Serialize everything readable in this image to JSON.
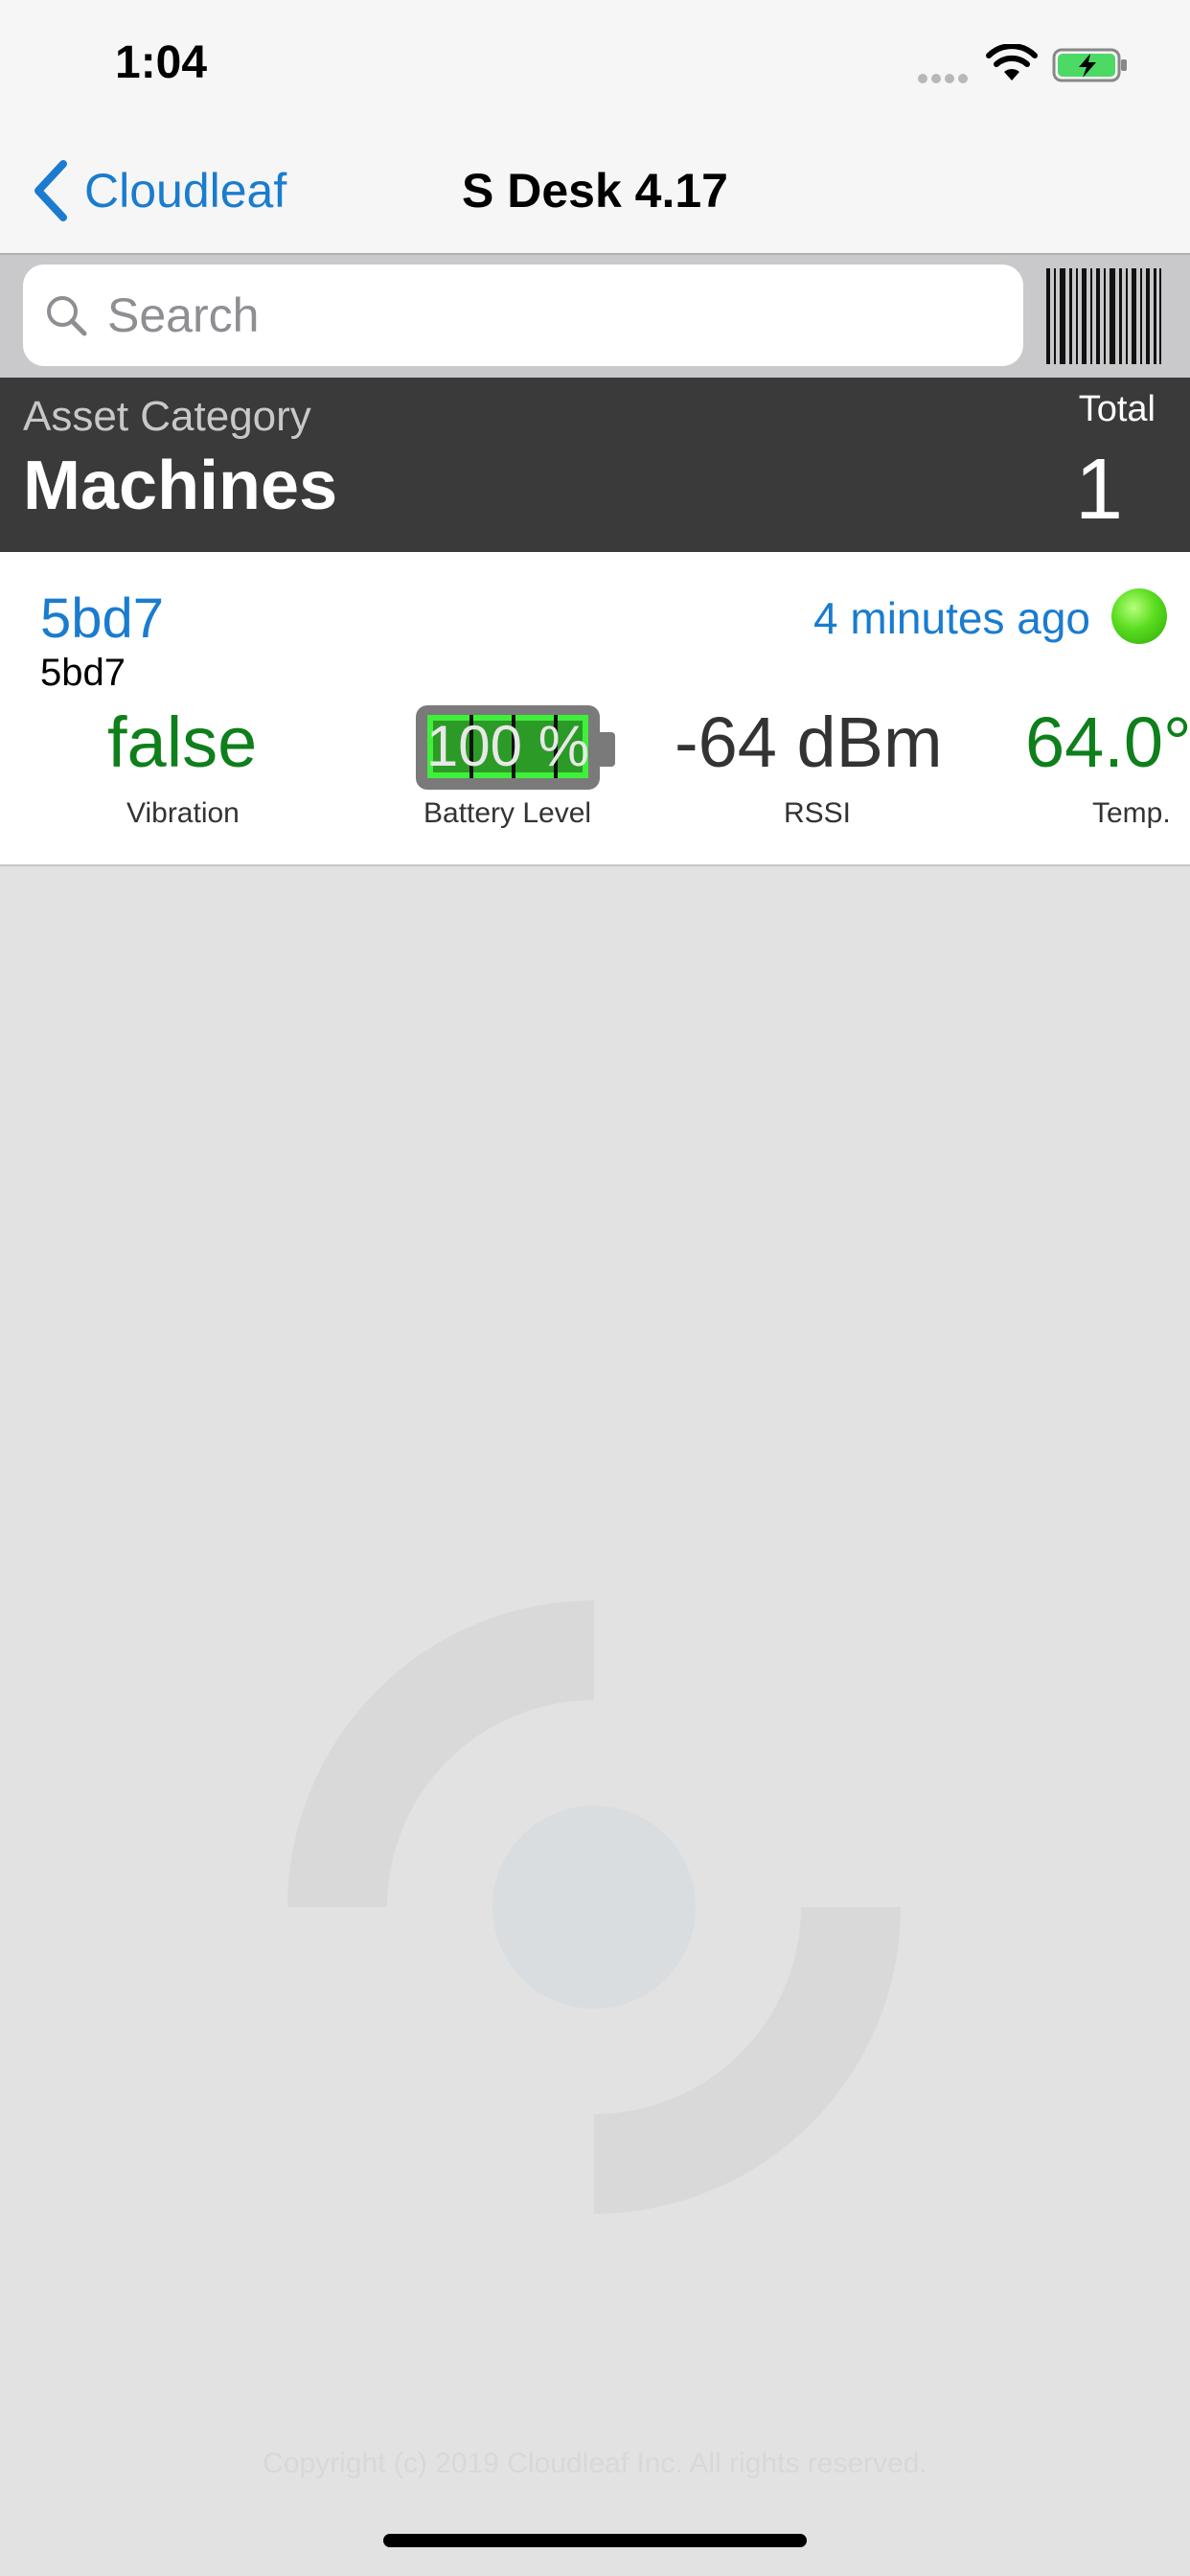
{
  "status_bar": {
    "time": "1:04"
  },
  "nav": {
    "back_label": "Cloudleaf",
    "title": "S Desk  4.17"
  },
  "search": {
    "placeholder": "Search"
  },
  "category": {
    "label": "Asset Category",
    "name": "Machines",
    "total_label": "Total",
    "total_value": "1"
  },
  "asset": {
    "id": "5bd7",
    "sub_id": "5bd7",
    "last_seen": "4 minutes ago",
    "status_color": "#59dc1e",
    "vibration": {
      "value": "false",
      "label": "Vibration"
    },
    "battery": {
      "value": "100 %",
      "level_percent": 100,
      "label": "Battery Level"
    },
    "rssi": {
      "value": "-64 dBm",
      "label": "RSSI"
    },
    "temp": {
      "value": "64.0°",
      "label": "Temp."
    }
  },
  "footer": {
    "copyright": "Copyright (c) 2019 Cloudleaf Inc. All rights reserved."
  },
  "colors": {
    "accent": "#1a7ccf",
    "good": "#0e7f1b",
    "header_bg": "#3a3a3a"
  }
}
